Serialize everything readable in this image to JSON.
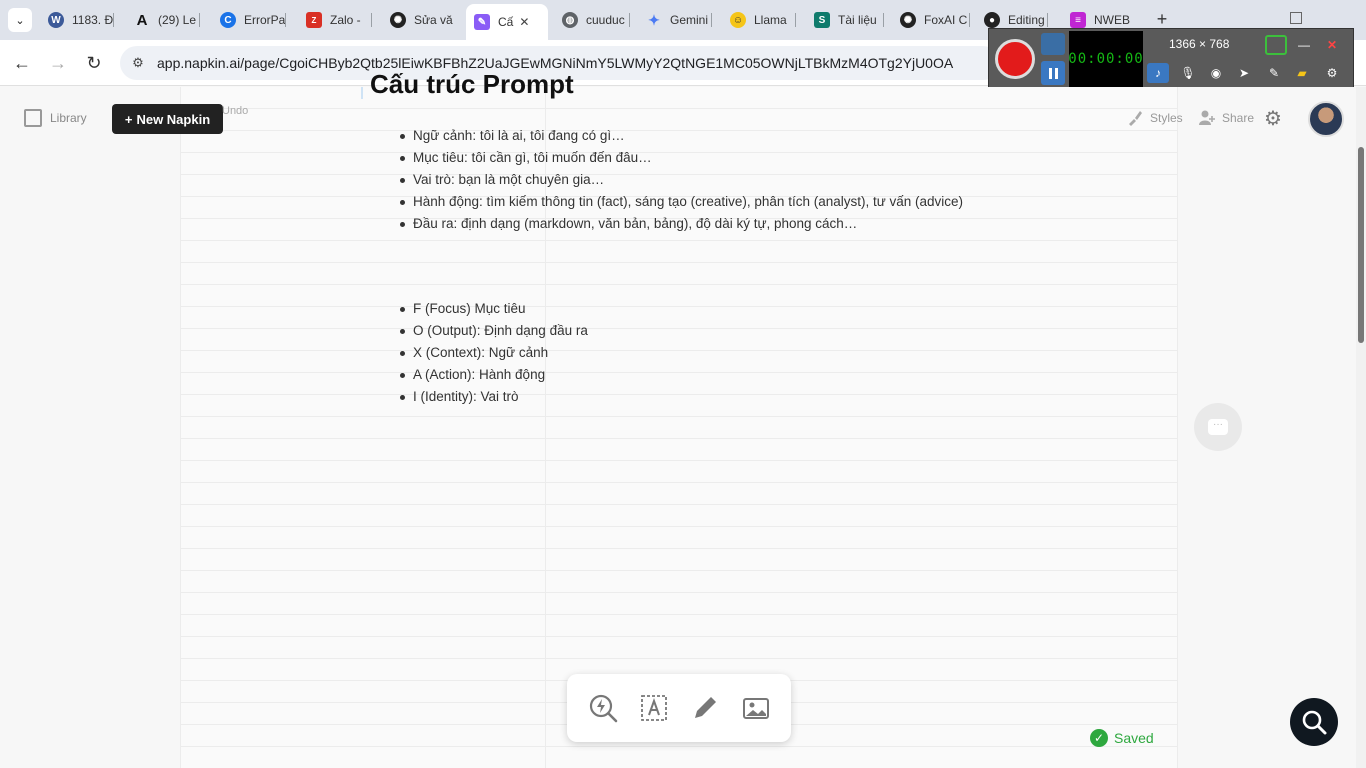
{
  "browser": {
    "tabs": [
      {
        "label": "1183. Đ",
        "icon": "wordpress-icon",
        "color": "#3c5a99"
      },
      {
        "label": "(29) Le",
        "icon": "letter-a-icon",
        "color": "#111111"
      },
      {
        "label": "ErrorPa",
        "icon": "c-logo-icon",
        "color": "#1a73e8"
      },
      {
        "label": "Zalo - ",
        "icon": "zalo-icon",
        "color": "#d93025"
      },
      {
        "label": "Sửa vă",
        "icon": "openai-icon",
        "color": "#222222"
      },
      {
        "label": "Cấ",
        "icon": "napkin-icon",
        "color": "#8a5cf6",
        "active": true
      },
      {
        "label": "cuuduc",
        "icon": "globe-icon",
        "color": "#5f6368"
      },
      {
        "label": "Gemini",
        "icon": "gemini-sparkle-icon",
        "color": "#4c7bf3"
      },
      {
        "label": "Llama",
        "icon": "llama-icon",
        "color": "#f5c518"
      },
      {
        "label": "Tài liệu",
        "icon": "sharepoint-icon",
        "color": "#0f7b6c"
      },
      {
        "label": "FoxAI C",
        "icon": "openai-icon",
        "color": "#222222"
      },
      {
        "label": "Editing",
        "icon": "github-icon",
        "color": "#222222"
      },
      {
        "label": "NWEB",
        "icon": "stack-icon",
        "color": "#c026d3"
      }
    ],
    "url": "app.napkin.ai/page/CgoiCHByb2Qtb25lEiwKBFBhZ2UaJGEwMGNiNmY5LWMyY2QtNGE1MC05OWNjLTBkMzM4OTg2YjU0OA"
  },
  "recorder": {
    "timer": "00:00:00",
    "resolution": "1366 × 768"
  },
  "app": {
    "library_label": "Library",
    "new_napkin_label": "New Napkin",
    "undo_label": "Undo",
    "styles_label": "Styles",
    "share_label": "Share",
    "title": "Cấu trúc Prompt",
    "list_a": [
      "Ngữ cảnh: tôi là ai, tôi đang có gì…",
      "Mục tiêu: tôi cần gì, tôi muốn đến đâu…",
      "Vai trò: bạn là một chuyên gia…",
      "Hành động: tìm kiếm thông tin (fact), sáng tạo (creative), phân tích (analyst), tư vấn (advice)",
      "Đầu ra: định dạng (markdown, văn bản, bảng), độ dài ký tự, phong cách…"
    ],
    "list_b": [
      "F (Focus) Mục tiêu",
      "O (Output): Định dạng đầu ra",
      "X (Context): Ngữ cảnh",
      "A (Action): Hành động",
      "I (Identity): Vai trò"
    ],
    "saved_label": "Saved",
    "colors": {
      "accent_dark": "#222222",
      "saved_green": "#2ea83f",
      "record_red": "#e21b1b"
    }
  }
}
